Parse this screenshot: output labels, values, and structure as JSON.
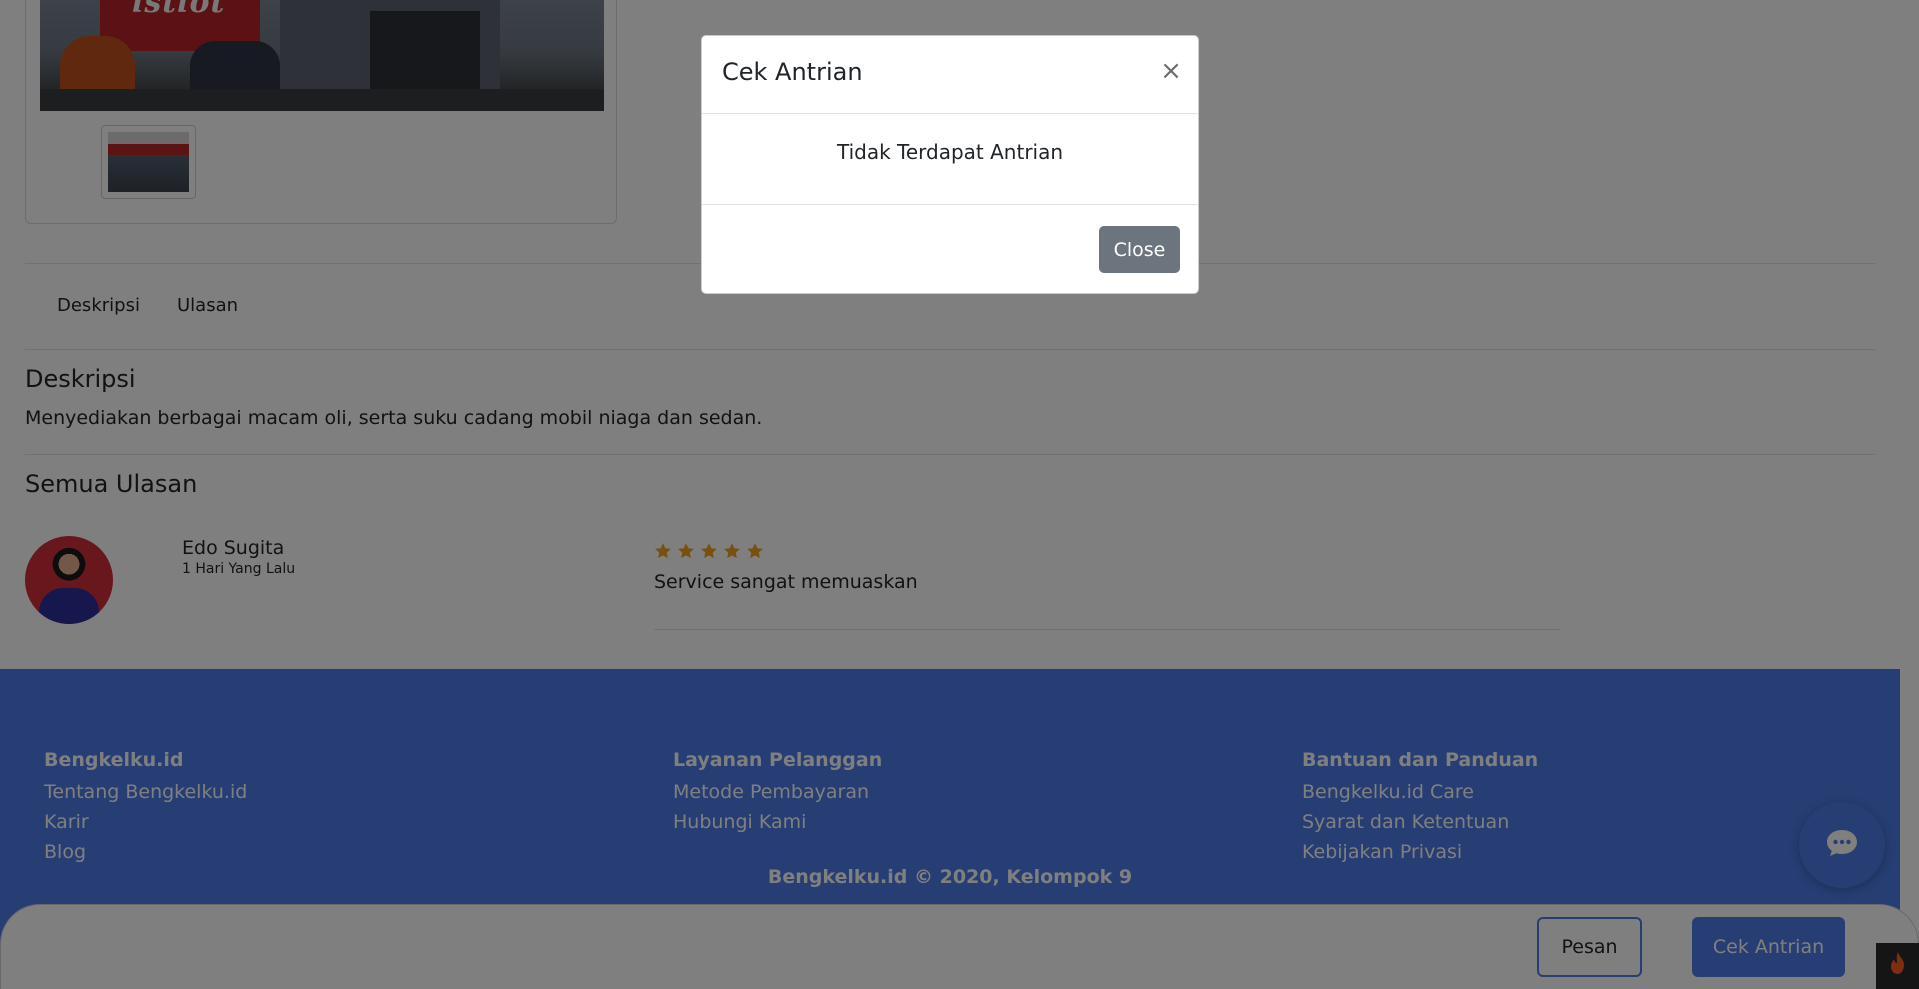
{
  "shop": {
    "photo_sign_text": "istiot"
  },
  "tabs": [
    {
      "label": "Deskripsi"
    },
    {
      "label": "Ulasan"
    }
  ],
  "description": {
    "heading": "Deskripsi",
    "text": "Menyediakan berbagai macam oli, serta suku cadang mobil niaga dan sedan."
  },
  "reviews": {
    "heading": "Semua Ulasan",
    "items": [
      {
        "name": "Edo Sugita",
        "time": "1 Hari Yang Lalu",
        "rating": 5,
        "text": "Service sangat memuaskan"
      }
    ]
  },
  "footer": {
    "columns": [
      {
        "title": "Bengkelku.id",
        "links": [
          "Tentang Bengkelku.id",
          "Karir",
          "Blog"
        ]
      },
      {
        "title": "Layanan Pelanggan",
        "links": [
          "Metode Pembayaran",
          "Hubungi Kami"
        ]
      },
      {
        "title": "Bantuan dan Panduan",
        "links": [
          "Bengkelku.id Care",
          "Syarat dan Ketentuan",
          "Kebijakan Privasi"
        ]
      }
    ],
    "copyright": "Bengkelku.id © 2020, Kelompok 9"
  },
  "actions": {
    "pesan_label": "Pesan",
    "cek_label": "Cek Antrian"
  },
  "modal": {
    "title": "Cek Antrian",
    "close_symbol": "×",
    "message": "Tidak Terdapat Antrian",
    "close_label": "Close"
  },
  "icons": {
    "chat": "chat-bubble-icon",
    "star": "star-icon",
    "fire": "fire-icon"
  },
  "colors": {
    "brand": "#4e7ce8",
    "star": "#f0a020",
    "close_button": "#6c757d",
    "fire": "#ff5a1f"
  }
}
